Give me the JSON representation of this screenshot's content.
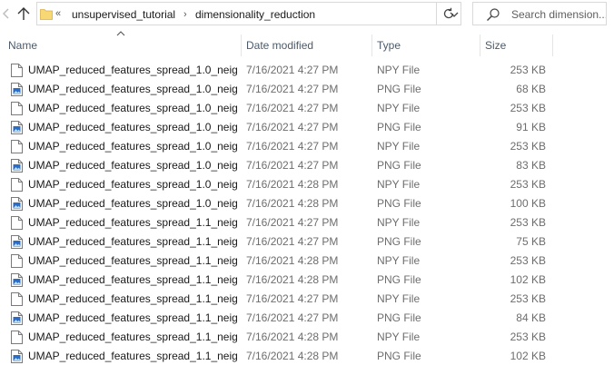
{
  "navigation": {
    "back_icon": "chevron-left-icon",
    "up_icon": "arrow-up-icon",
    "overflow_label": "«",
    "breadcrumb": [
      "unsupervised_tutorial",
      "dimensionality_reduction"
    ],
    "separator": "›",
    "refresh_icon": "refresh-icon",
    "dropdown_icon": "chevron-down-icon"
  },
  "search": {
    "placeholder": "Search dimension..."
  },
  "columns": {
    "name": "Name",
    "date_modified": "Date modified",
    "type": "Type",
    "size": "Size"
  },
  "sort": {
    "column": "Name",
    "direction": "ascending"
  },
  "files": [
    {
      "name": "UMAP_reduced_features_spread_1.0_neig...",
      "date": "7/16/2021 4:27 PM",
      "type": "NPY File",
      "size": "253 KB",
      "icon": "generic-file-icon"
    },
    {
      "name": "UMAP_reduced_features_spread_1.0_neig...",
      "date": "7/16/2021 4:27 PM",
      "type": "PNG File",
      "size": "68 KB",
      "icon": "image-file-icon"
    },
    {
      "name": "UMAP_reduced_features_spread_1.0_neig...",
      "date": "7/16/2021 4:27 PM",
      "type": "NPY File",
      "size": "253 KB",
      "icon": "generic-file-icon"
    },
    {
      "name": "UMAP_reduced_features_spread_1.0_neig...",
      "date": "7/16/2021 4:27 PM",
      "type": "PNG File",
      "size": "91 KB",
      "icon": "image-file-icon"
    },
    {
      "name": "UMAP_reduced_features_spread_1.0_neig...",
      "date": "7/16/2021 4:27 PM",
      "type": "NPY File",
      "size": "253 KB",
      "icon": "generic-file-icon"
    },
    {
      "name": "UMAP_reduced_features_spread_1.0_neig...",
      "date": "7/16/2021 4:27 PM",
      "type": "PNG File",
      "size": "83 KB",
      "icon": "image-file-icon"
    },
    {
      "name": "UMAP_reduced_features_spread_1.0_neig...",
      "date": "7/16/2021 4:28 PM",
      "type": "NPY File",
      "size": "253 KB",
      "icon": "generic-file-icon"
    },
    {
      "name": "UMAP_reduced_features_spread_1.0_neig...",
      "date": "7/16/2021 4:28 PM",
      "type": "PNG File",
      "size": "100 KB",
      "icon": "image-file-icon"
    },
    {
      "name": "UMAP_reduced_features_spread_1.1_neig...",
      "date": "7/16/2021 4:27 PM",
      "type": "NPY File",
      "size": "253 KB",
      "icon": "generic-file-icon"
    },
    {
      "name": "UMAP_reduced_features_spread_1.1_neig...",
      "date": "7/16/2021 4:27 PM",
      "type": "PNG File",
      "size": "75 KB",
      "icon": "image-file-icon"
    },
    {
      "name": "UMAP_reduced_features_spread_1.1_neig...",
      "date": "7/16/2021 4:28 PM",
      "type": "NPY File",
      "size": "253 KB",
      "icon": "generic-file-icon"
    },
    {
      "name": "UMAP_reduced_features_spread_1.1_neig...",
      "date": "7/16/2021 4:28 PM",
      "type": "PNG File",
      "size": "102 KB",
      "icon": "image-file-icon"
    },
    {
      "name": "UMAP_reduced_features_spread_1.1_neig...",
      "date": "7/16/2021 4:27 PM",
      "type": "NPY File",
      "size": "253 KB",
      "icon": "generic-file-icon"
    },
    {
      "name": "UMAP_reduced_features_spread_1.1_neig...",
      "date": "7/16/2021 4:27 PM",
      "type": "PNG File",
      "size": "84 KB",
      "icon": "image-file-icon"
    },
    {
      "name": "UMAP_reduced_features_spread_1.1_neig...",
      "date": "7/16/2021 4:28 PM",
      "type": "NPY File",
      "size": "253 KB",
      "icon": "generic-file-icon"
    },
    {
      "name": "UMAP_reduced_features_spread_1.1_neig...",
      "date": "7/16/2021 4:28 PM",
      "type": "PNG File",
      "size": "102 KB",
      "icon": "image-file-icon"
    }
  ],
  "colors": {
    "folder": "#f8d775",
    "image_icon_blue": "#2b6cc4",
    "header_text": "#4c5a6a",
    "secondary_text": "#6d6d6d"
  }
}
